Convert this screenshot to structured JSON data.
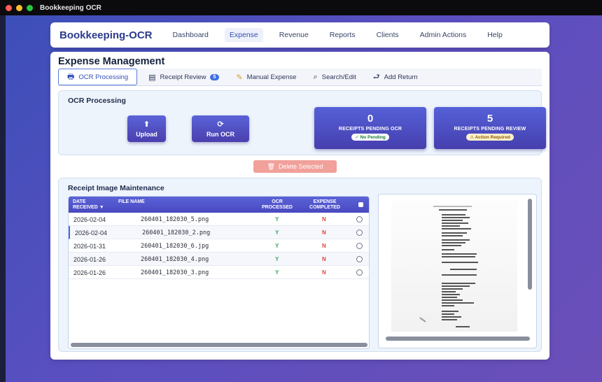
{
  "window": {
    "title": "Bookkeeping OCR"
  },
  "navbar": {
    "brand": "Bookkeeping-OCR",
    "items": [
      "Dashboard",
      "Expense",
      "Revenue",
      "Reports",
      "Clients",
      "Admin Actions",
      "Help"
    ],
    "active": "Expense"
  },
  "page": {
    "title": "Expense Management"
  },
  "tabs": [
    {
      "label": "OCR Processing",
      "icon": "printer-icon",
      "active": true
    },
    {
      "label": "Receipt Review",
      "icon": "document-icon",
      "badge": "5"
    },
    {
      "label": "Manual Expense",
      "icon": "pencil-icon"
    },
    {
      "label": "Search/Edit",
      "icon": "magnifier-icon"
    },
    {
      "label": "Add Return",
      "icon": "return-icon"
    }
  ],
  "ocr": {
    "title": "OCR Processing",
    "upload_label": "Upload",
    "run_label": "Run OCR",
    "pending_ocr": {
      "value": "0",
      "label": "RECEIPTS PENDING OCR",
      "status": "✓ No Pending"
    },
    "pending_review": {
      "value": "5",
      "label": "RECEIPTS PENDING REVIEW",
      "status": "⚠ Action Required"
    }
  },
  "delete_label": "Delete Selected",
  "maintenance": {
    "title": "Receipt Image Maintenance",
    "columns": {
      "date_line1": "DATE",
      "date_line2": "RECEIVED ▼",
      "file": "FILE NAME",
      "ocr_line1": "OCR",
      "ocr_line2": "PROCESSED",
      "exp_line1": "EXPENSE",
      "exp_line2": "COMPLETED"
    },
    "rows": [
      {
        "date": "2026-02-04",
        "file": "260401_182030_5.png",
        "ocr": "Y",
        "expense": "N"
      },
      {
        "date": "2026-02-04",
        "file": "260401_182030_2.png",
        "ocr": "Y",
        "expense": "N"
      },
      {
        "date": "2026-01-31",
        "file": "260401_182030_6.jpg",
        "ocr": "Y",
        "expense": "N"
      },
      {
        "date": "2026-01-26",
        "file": "260401_182030_4.png",
        "ocr": "Y",
        "expense": "N"
      },
      {
        "date": "2026-01-26",
        "file": "260401_182030_3.png",
        "ocr": "Y",
        "expense": "N"
      }
    ]
  }
}
